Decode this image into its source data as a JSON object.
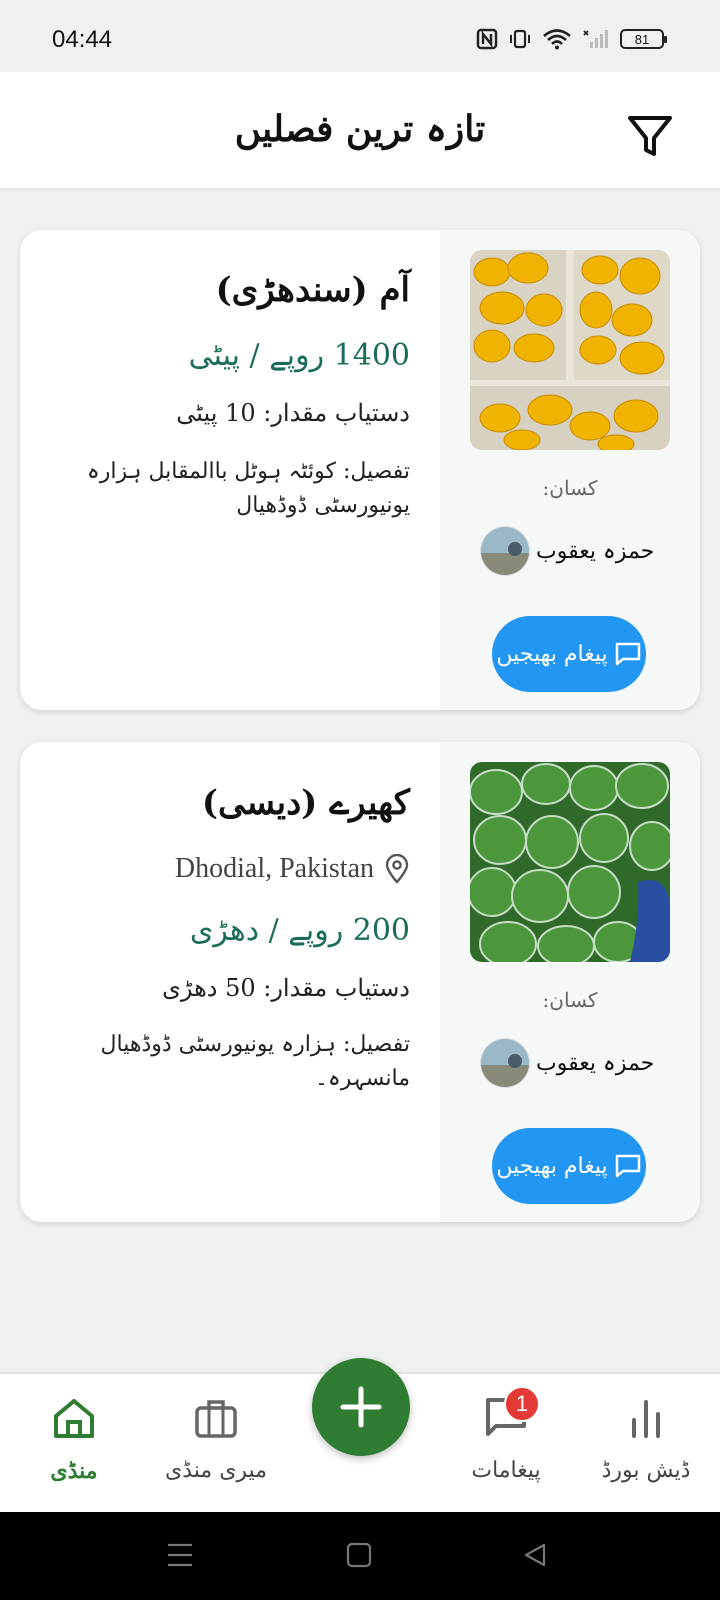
{
  "status_bar": {
    "time": "04:44",
    "battery": "81"
  },
  "header": {
    "title": "تازہ ترین فصلیں"
  },
  "listings": [
    {
      "crop_name": "آم (سندھڑی)",
      "location": "",
      "price": "1400 روپے / پیٹی",
      "quantity": "دستیاب مقدار: 10 پیٹی",
      "details": "تفصیل: کوئٹہ ہوٹل باالمقابل ہزارہ یونیورسٹی ڈوڈھیال",
      "farmer_label": "کسان:",
      "farmer_name": "حمزہ یعقوب",
      "message_button": "پیغام بھیجیں",
      "image": "mangoes-photo"
    },
    {
      "crop_name": "کھیرے (دیسی)",
      "location": "Dhodial, Pakistan",
      "price": "200 روپے / دھڑی",
      "quantity": "دستیاب مقدار: 50 دھڑی",
      "details": "تفصیل: ہزارہ یونیورسٹی ڈوڈھیال مانسہرہ۔",
      "farmer_label": "کسان:",
      "farmer_name": "حمزہ یعقوب",
      "message_button": "پیغام بھیجیں",
      "image": "cucumbers-photo"
    }
  ],
  "bottom_nav": {
    "items": [
      {
        "label": "منڈی",
        "icon": "home-icon",
        "active": true
      },
      {
        "label": "میری منڈی",
        "icon": "briefcase-icon",
        "active": false
      },
      {
        "label": "پیغامات",
        "icon": "chat-icon",
        "active": false,
        "badge": "1"
      },
      {
        "label": "ڈیش بورڈ",
        "icon": "bar-chart-icon",
        "active": false
      }
    ],
    "fab_icon": "plus-icon"
  },
  "colors": {
    "primary_green": "#2e7d32",
    "price_teal": "#1b6d5a",
    "button_blue": "#2196f3",
    "badge_red": "#e53935"
  }
}
